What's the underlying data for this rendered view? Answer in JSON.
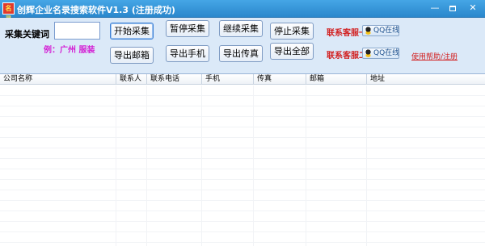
{
  "window": {
    "icon_text": "名录",
    "title": "创辉企业名录搜索软件V1.3  (注册成功)",
    "minimize": "—",
    "close": "✕"
  },
  "toolbar": {
    "keyword_label": "采集关键词",
    "keyword_value": "",
    "example": "例：广州   服装",
    "buttons": {
      "start": "开始采集",
      "pause": "暂停采集",
      "resume": "继续采集",
      "stop": "停止采集",
      "export_email": "导出邮箱",
      "export_mobile": "导出手机",
      "export_fax": "导出传真",
      "export_all": "导出全部"
    },
    "support1_label": "联系客服一:",
    "support2_label": "联系客服二:",
    "qq_label": "QQ在线",
    "help_link": "使用帮助/注册"
  },
  "table": {
    "columns": [
      "公司名称",
      "联系人",
      "联系电话",
      "手机",
      "传真",
      "邮箱",
      "地址"
    ],
    "rows": []
  },
  "colors": {
    "titlebar": "#2a87cc",
    "toolbar_bg": "#dbe9f8",
    "accent_red": "#d21f1f",
    "example_magenta": "#d41fd4"
  }
}
